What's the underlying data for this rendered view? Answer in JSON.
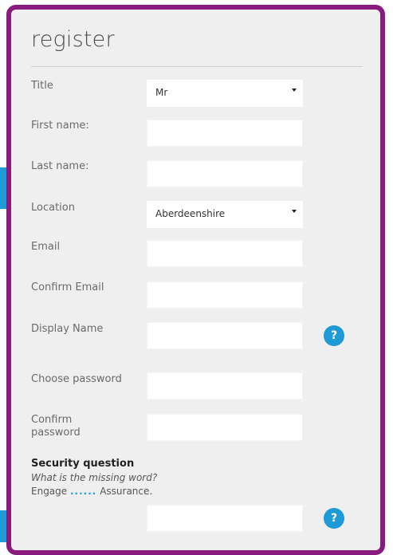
{
  "form": {
    "heading": "register",
    "title_label": "Title",
    "title_value": "Mr",
    "first_name_label": "First name:",
    "first_name_value": "",
    "last_name_label": "Last name:",
    "last_name_value": "",
    "location_label": "Location",
    "location_value": "Aberdeenshire",
    "email_label": "Email",
    "email_value": "",
    "confirm_email_label": "Confirm Email",
    "confirm_email_value": "",
    "display_name_label": "Display Name",
    "display_name_value": "",
    "choose_password_label": "Choose password",
    "choose_password_value": "",
    "confirm_password_label_line1": "Confirm",
    "confirm_password_label_line2": "password",
    "confirm_password_value": "",
    "help_glyph": "?",
    "security": {
      "title": "Security question",
      "question": "What is the missing word?",
      "hint_prefix": "Engage",
      "hint_dots": "......",
      "hint_suffix": "Assurance.",
      "answer_value": ""
    }
  },
  "colors": {
    "border": "#8a1b7e",
    "accent": "#1e9ad6",
    "panel_bg": "#efefef"
  },
  "icons": {
    "help": "help-circle-icon",
    "dropdown": "caret-down-icon"
  }
}
